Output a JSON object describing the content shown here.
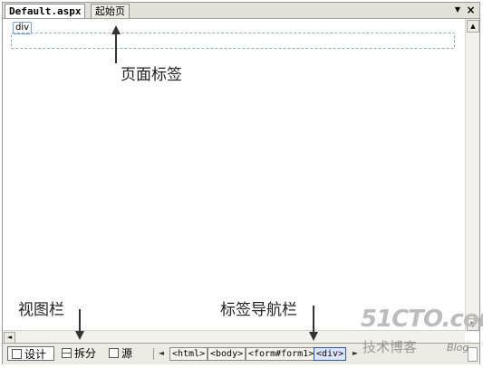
{
  "tabs": [
    {
      "label": "Default.aspx",
      "active": true
    },
    {
      "label": "起始页",
      "active": false
    }
  ],
  "tab_controls": {
    "menu_icon": "triangle-down-icon",
    "close_icon": "close-icon",
    "menu_glyph": "▼",
    "close_glyph": "×"
  },
  "design_surface": {
    "element_tag": "div"
  },
  "view_buttons": [
    {
      "label": "设计",
      "icon": "design-view-icon",
      "selected": true
    },
    {
      "label": "拆分",
      "icon": "split-view-icon",
      "selected": false
    },
    {
      "label": "源",
      "icon": "source-view-icon",
      "selected": false
    }
  ],
  "tag_navigator": {
    "left_arrow": "◄",
    "right_arrow": "►",
    "crumbs": [
      "<html>",
      "<body>",
      "<form#form1>",
      "<div>"
    ],
    "active_index": 3
  },
  "scrollbars": {
    "up": "▲",
    "down": "▼",
    "left": "◄"
  },
  "annotations": {
    "page_tabs": "页面标签",
    "view_bar": "视图栏",
    "tag_nav_bar": "标签导航栏"
  },
  "watermark": {
    "main": "51CTO.com",
    "sub": "技术博客",
    "blog": "Blog"
  }
}
